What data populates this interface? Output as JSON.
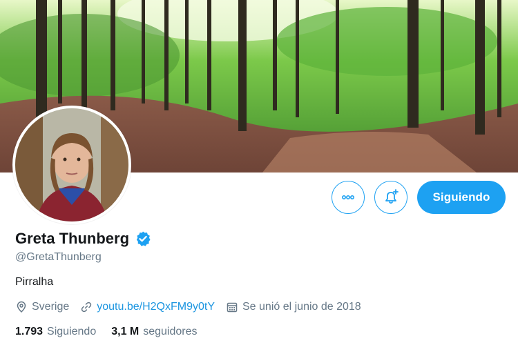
{
  "profile": {
    "name": "Greta Thunberg",
    "handle": "@GretaThunberg",
    "verified": true,
    "bio": "Pirralha",
    "location": "Sverige",
    "website": "youtu.be/H2QxFM9y0tY",
    "joined": "Se unió el junio de 2018",
    "following_count": "1.793",
    "following_label": "Siguiendo",
    "followers_count": "3,1 M",
    "followers_label": "seguidores"
  },
  "actions": {
    "more_icon": "more-horizontal-icon",
    "notify_icon": "bell-plus-icon",
    "follow_label": "Siguiendo"
  },
  "colors": {
    "accent": "#1da1f2",
    "link": "#1b95e0",
    "secondary_text": "#657786"
  }
}
